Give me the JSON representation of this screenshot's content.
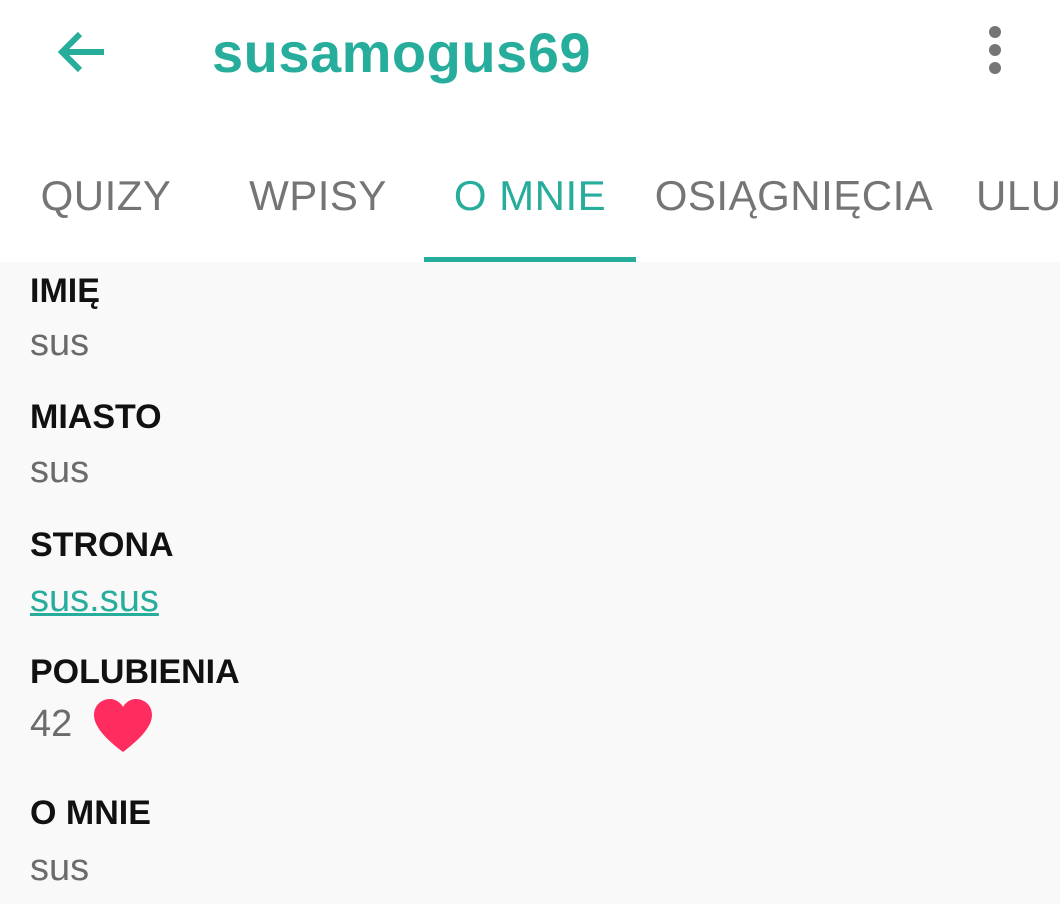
{
  "appbar": {
    "title": "susamogus69",
    "back_icon": "arrow-left-icon",
    "menu_icon": "more-vert-icon"
  },
  "tabs": [
    {
      "label": "QUIZY",
      "active": false
    },
    {
      "label": "WPISY",
      "active": false
    },
    {
      "label": "O MNIE",
      "active": true
    },
    {
      "label": "OSIĄGNIĘCIA",
      "active": false
    },
    {
      "label": "ULUB",
      "active": false
    }
  ],
  "profile": {
    "name_label": "IMIĘ",
    "name_value": "sus",
    "city_label": "MIASTO",
    "city_value": "sus",
    "site_label": "STRONA",
    "site_value": "sus.sus",
    "likes_label": "POLUBIENIA",
    "likes_value": "42",
    "likes_icon": "heart-icon",
    "about_label": "O MNIE",
    "about_value": "sus"
  },
  "colors": {
    "accent": "#27ad9b",
    "heart": "#ff2d5f",
    "background": "#f9f9f9"
  }
}
